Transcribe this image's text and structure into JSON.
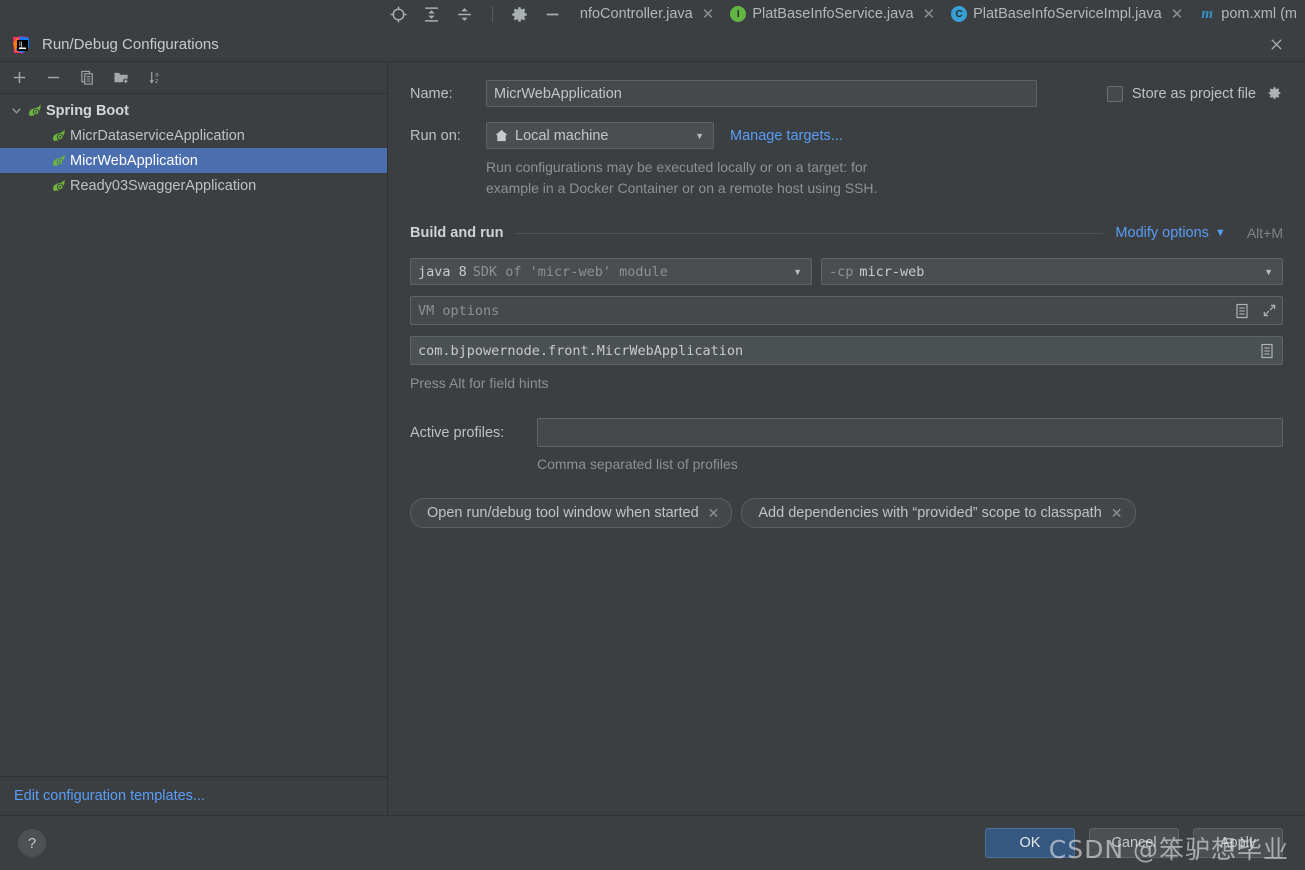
{
  "ide_tabs": {
    "toolbar_icons": [
      {
        "name": "target-icon",
        "glyph": "locate"
      },
      {
        "name": "expand-all-icon",
        "glyph": "expandall"
      },
      {
        "name": "collapse-all-icon",
        "glyph": "collapseall"
      },
      {
        "name": "settings-gear-icon",
        "glyph": "gear"
      },
      {
        "name": "hide-icon",
        "glyph": "minus"
      }
    ],
    "tabs": [
      {
        "label": "nfoController.java",
        "badge": "",
        "badge_type": "none",
        "closable": true
      },
      {
        "label": "PlatBaseInfoService.java",
        "badge": "I",
        "badge_type": "interface",
        "closable": true
      },
      {
        "label": "PlatBaseInfoServiceImpl.java",
        "badge": "C",
        "badge_type": "class",
        "closable": true
      },
      {
        "label": "pom.xml (m",
        "badge": "m",
        "badge_type": "maven",
        "closable": false
      }
    ]
  },
  "dialog": {
    "title": "Run/Debug Configurations",
    "close_label": "✕"
  },
  "left_panel": {
    "toolbar": [
      {
        "name": "add-configuration-button",
        "glyph": "plus"
      },
      {
        "name": "remove-configuration-button",
        "glyph": "minus"
      },
      {
        "name": "copy-configuration-button",
        "glyph": "copy"
      },
      {
        "name": "new-folder-button",
        "glyph": "folder-add"
      },
      {
        "name": "sort-alphabetically-button",
        "glyph": "sort-az"
      }
    ],
    "tree": {
      "group_label": "Spring Boot",
      "items": [
        {
          "label": "MicrDataserviceApplication",
          "selected": false
        },
        {
          "label": "MicrWebApplication",
          "selected": true
        },
        {
          "label": "Ready03SwaggerApplication",
          "selected": false
        }
      ]
    },
    "footer_link": "Edit configuration templates..."
  },
  "form": {
    "name_label": "Name:",
    "name_value": "MicrWebApplication",
    "store_as_project_file_label": "Store as project file",
    "store_as_project_file_checked": false,
    "run_on_label": "Run on:",
    "run_on_value": "Local machine",
    "manage_targets_link": "Manage targets...",
    "target_help_line1": "Run configurations may be executed locally or on a target: for",
    "target_help_line2": "example in a Docker Container or on a remote host using SSH.",
    "build_and_run_label": "Build and run",
    "modify_options_label": "Modify options",
    "modify_options_shortcut": "Alt+M",
    "jdk_value_bright": "java 8",
    "jdk_value_dim": "SDK of 'micr-web' module",
    "cp_value_dim": "-cp",
    "cp_value_bright": "micr-web",
    "vm_options_placeholder": "VM options",
    "main_class_value": "com.bjpowernode.front.MicrWebApplication",
    "field_hints": "Press Alt for field hints",
    "active_profiles_label": "Active profiles:",
    "active_profiles_value": "",
    "active_profiles_hint": "Comma separated list of profiles",
    "chips": [
      {
        "label": "Open run/debug tool window when started",
        "close": "✕"
      },
      {
        "label": "Add dependencies with “provided” scope to classpath",
        "close": "✕"
      }
    ]
  },
  "footer": {
    "help_label": "?",
    "ok_label": "OK",
    "cancel_label": "Cancel",
    "apply_label": "Apply"
  },
  "watermark": "CSDN @笨驴想毕业",
  "colors": {
    "background": "#3c3f41",
    "selection": "#4b6eaf",
    "link": "#589df6",
    "default_button": "#365880",
    "spring_green": "#6cb33f"
  }
}
